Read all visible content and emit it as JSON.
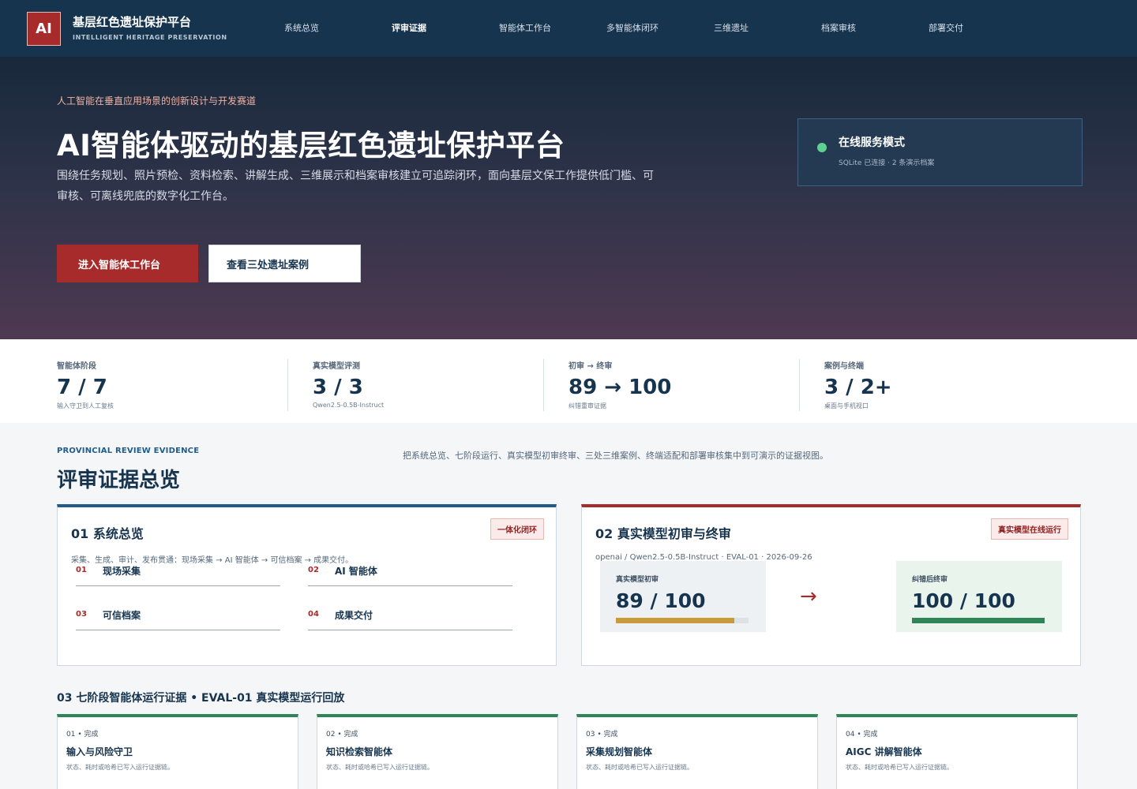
{
  "header": {
    "logo": "AI",
    "title": "基层红色遗址保护平台",
    "subtitle": "INTELLIGENT HERITAGE PRESERVATION",
    "nav": [
      "系统总览",
      "评审证据",
      "智能体工作台",
      "多智能体闭环",
      "三维遗址",
      "档案审核",
      "部署交付"
    ],
    "active_nav": "评审证据"
  },
  "hero": {
    "eyebrow": "人工智能在垂直应用场景的创新设计与开发赛道",
    "title": "AI智能体驱动的基层红色遗址保护平台",
    "description": "围绕任务规划、照片预检、资料检索、讲解生成、三维展示和档案审核建立可追踪闭环，面向基层文保工作提供低门槛、可审核、可离线兜底的数字化工作台。",
    "primary_button": "进入智能体工作台",
    "secondary_button": "查看三处遗址案例",
    "status": {
      "title": "在线服务模式",
      "subtitle": "SQLite 已连接 · 2 条演示档案",
      "dot_color": "#5ed190"
    }
  },
  "stats": [
    {
      "label": "智能体阶段",
      "value": "7 / 7",
      "sub": "输入守卫到人工复核"
    },
    {
      "label": "真实模型评测",
      "value": "3 / 3",
      "sub": "Qwen2.5-0.5B-Instruct"
    },
    {
      "label": "初审 → 终审",
      "value": "89 → 100",
      "sub": "纠错重审证据"
    },
    {
      "label": "案例与终端",
      "value": "3 / 2+",
      "sub": "桌面与手机视口"
    }
  ],
  "section": {
    "eyebrow": "PROVINCIAL REVIEW EVIDENCE",
    "title": "评审证据总览",
    "description": "把系统总览、七阶段运行、真实模型初审终审、三处三维案例、终端适配和部署审核集中到可演示的证据视图。"
  },
  "overview_panel": {
    "title": "01 系统总览",
    "tag": "一体化闭环",
    "description": "采集、生成、审计、发布贯通：现场采集 → AI 智能体 → 可信档案 → 成果交付。",
    "flow": [
      {
        "num": "01",
        "label": "现场采集"
      },
      {
        "num": "02",
        "label": "AI 智能体"
      },
      {
        "num": "03",
        "label": "可信档案"
      },
      {
        "num": "04",
        "label": "成果交付"
      }
    ]
  },
  "review_panel": {
    "title": "02 真实模型初审与终审",
    "tag": "真实模型在线运行",
    "meta": "openai / Qwen2.5-0.5B-Instruct · EVAL-01 · 2026-09-26",
    "initial": {
      "label": "真实模型初审",
      "value": "89 / 100",
      "score": 89
    },
    "final": {
      "label": "纠错后终审",
      "value": "100 / 100",
      "score": 100
    },
    "arrow": "→"
  },
  "stages": {
    "title": "03 七阶段智能体运行证据 • EVAL-01 真实模型运行回放",
    "items": [
      {
        "meta": "01 • 完成",
        "name": "输入与风险守卫",
        "desc": "状态、耗时或哈希已写入运行证据链。"
      },
      {
        "meta": "02 • 完成",
        "name": "知识检索智能体",
        "desc": "状态、耗时或哈希已写入运行证据链。"
      },
      {
        "meta": "03 • 完成",
        "name": "采集规划智能体",
        "desc": "状态、耗时或哈希已写入运行证据链。"
      },
      {
        "meta": "04 • 完成",
        "name": "AIGC 讲解智能体",
        "desc": "状态、耗时或哈希已写入运行证据链。"
      }
    ]
  },
  "colors": {
    "header_bg": "#17344f",
    "accent_red": "#a82b2b",
    "accent_blue": "#1f5c8b",
    "success_green": "#2f8559",
    "gold": "#c99a39"
  }
}
